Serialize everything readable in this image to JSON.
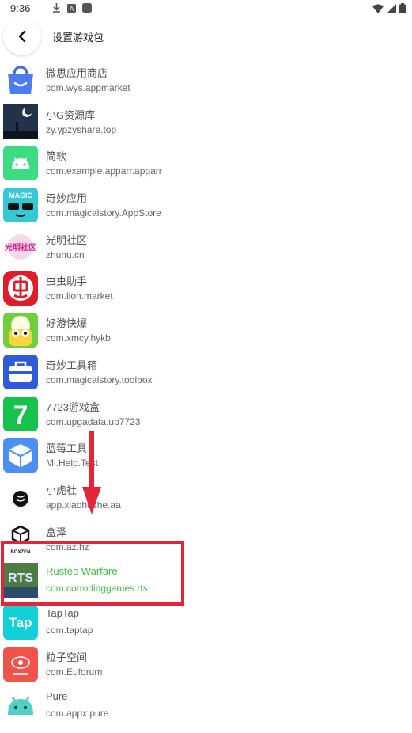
{
  "status_bar": {
    "time": "9:36"
  },
  "header": {
    "title": "设置游戏包"
  },
  "apps": [
    {
      "name": "微思应用商店",
      "package": "com.wys.appmarket",
      "icon": "shopping-bag-icon",
      "color": "#3f6fe6"
    },
    {
      "name": "小G资源库",
      "package": "zy.ypzyshare.top",
      "icon": "night-sky-icon",
      "color": "#1c2433"
    },
    {
      "name": "简软",
      "package": "com.example.apparr.apparr",
      "icon": "android-icon",
      "color": "#3ddc84"
    },
    {
      "name": "奇妙应用",
      "package": "com.magicalstory.AppStore",
      "icon": "magic-face-icon",
      "color": "#33c9d6"
    },
    {
      "name": "光明社区",
      "package": "zhunu.cn",
      "icon": "guangming-logo-icon",
      "color": "#d2208b"
    },
    {
      "name": "虫虫助手",
      "package": "com.lion.market",
      "icon": "chongchong-logo-icon",
      "color": "#e01b2a"
    },
    {
      "name": "好游快爆",
      "package": "com.xmcy.hykb",
      "icon": "haoyou-mascot-icon",
      "color": "#6fcf3e"
    },
    {
      "name": "奇妙工具箱",
      "package": "com.magicalstory.toolbox",
      "icon": "toolbox-icon",
      "color": "#2f5bd8"
    },
    {
      "name": "7723游戏盒",
      "package": "com.upgadata.up7723",
      "icon": "seven-logo-icon",
      "color": "#14c24c"
    },
    {
      "name": "蓝莓工具",
      "package": "Mi.Help.Test",
      "icon": "cube-icon",
      "color": "#4a8ff2"
    },
    {
      "name": "小虎社",
      "package": "app.xiaohushe.aa",
      "icon": "tiger-logo-icon",
      "color": "#111111"
    },
    {
      "name": "盒泽",
      "package": "com.az.hz",
      "icon": "box-logo-icon",
      "color": "#111111"
    },
    {
      "name": "Rusted Warfare",
      "package": "com.corrodinggames.rts",
      "icon": "rts-game-icon",
      "color": "#3b6b3a",
      "selected": true
    },
    {
      "name": "TapTap",
      "package": "com.taptap",
      "icon": "taptap-logo-icon",
      "color": "#12d0d8"
    },
    {
      "name": "粒子空间",
      "package": "com.Euforum",
      "icon": "particle-logo-icon",
      "color": "#f0524c"
    },
    {
      "name": "Pure",
      "package": "com.appx.pure",
      "icon": "pure-android-icon",
      "color": "#4fd1c5"
    }
  ],
  "icon_texts": {
    "magic": "MAGIC",
    "guangming": "光明社区",
    "tap": "Tap",
    "rts": "RTS",
    "boxzen": "BOXZEN",
    "seven": "7"
  },
  "annotation": {
    "color": "#e5243a"
  }
}
